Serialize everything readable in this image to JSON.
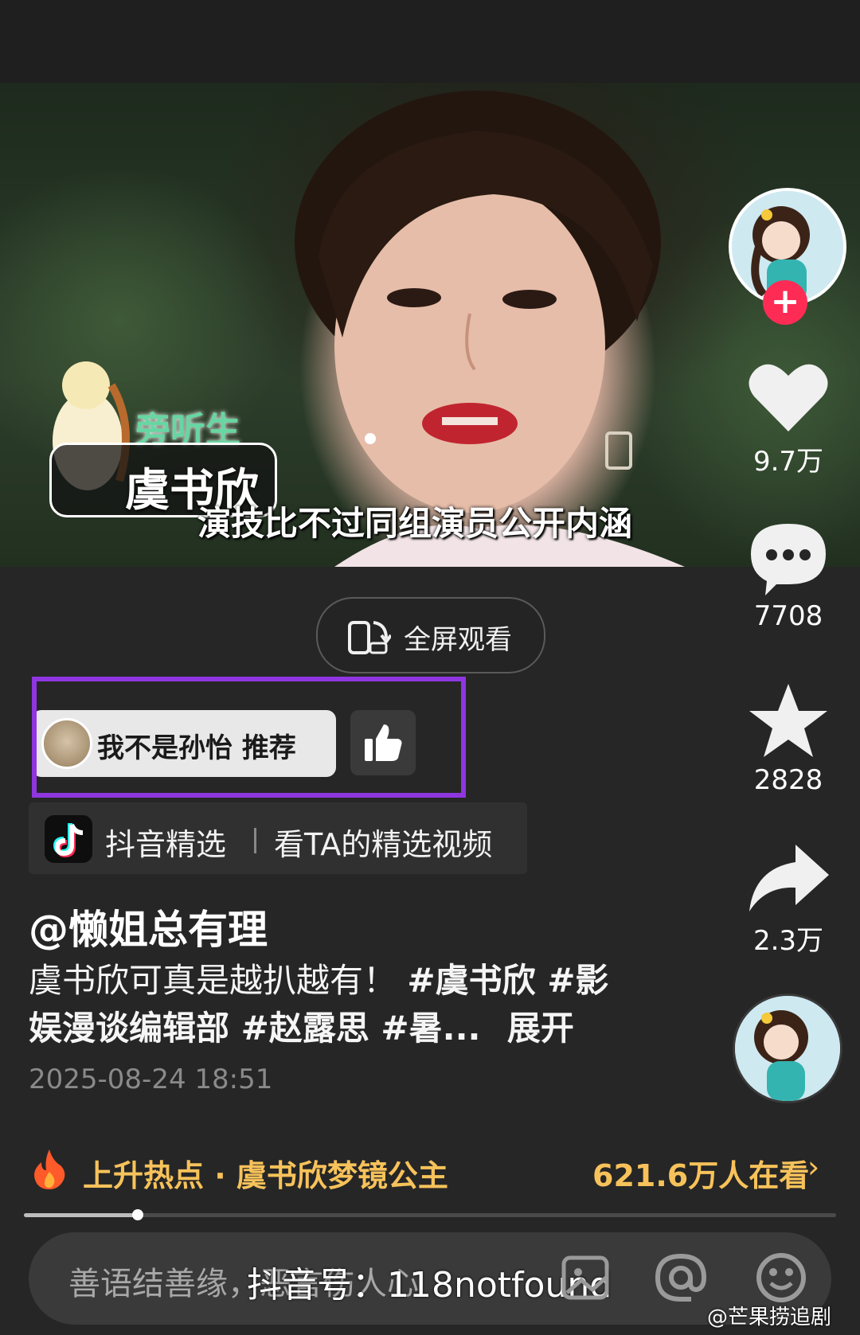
{
  "video": {
    "role_label": "旁听生",
    "name_label": "虞书欣",
    "subtitle": "演技比不过同组演员公开内涵"
  },
  "side_actions": {
    "likes": "9.7万",
    "comments": "7708",
    "favorites": "2828",
    "shares": "2.3万",
    "follow_symbol": "+"
  },
  "fullscreen": {
    "label": "全屏观看"
  },
  "recommend": {
    "text": "我不是孙怡 推荐"
  },
  "jingxuan": {
    "label": "抖音精选",
    "link": "看TA的精选视频"
  },
  "post": {
    "author": "@懒姐总有理",
    "text": "虞书欣可真是越扒越有！",
    "tags_line1": "#虞书欣 #影",
    "line2": "娱漫谈编辑部 #赵露思 #暑...",
    "expand": "展开",
    "date": "2025-08-24 18:51"
  },
  "hot": {
    "label": "上升热点 · 虞书欣梦镜公主",
    "viewers": "621.6万人在看",
    "arrow": "›"
  },
  "progress": {
    "fraction": 0.14
  },
  "comment_bar": {
    "placeholder": "善语结善缘，恶言伤人心",
    "watermark": "抖音号：118notfound",
    "watermark2": "@芒果捞追剧"
  }
}
